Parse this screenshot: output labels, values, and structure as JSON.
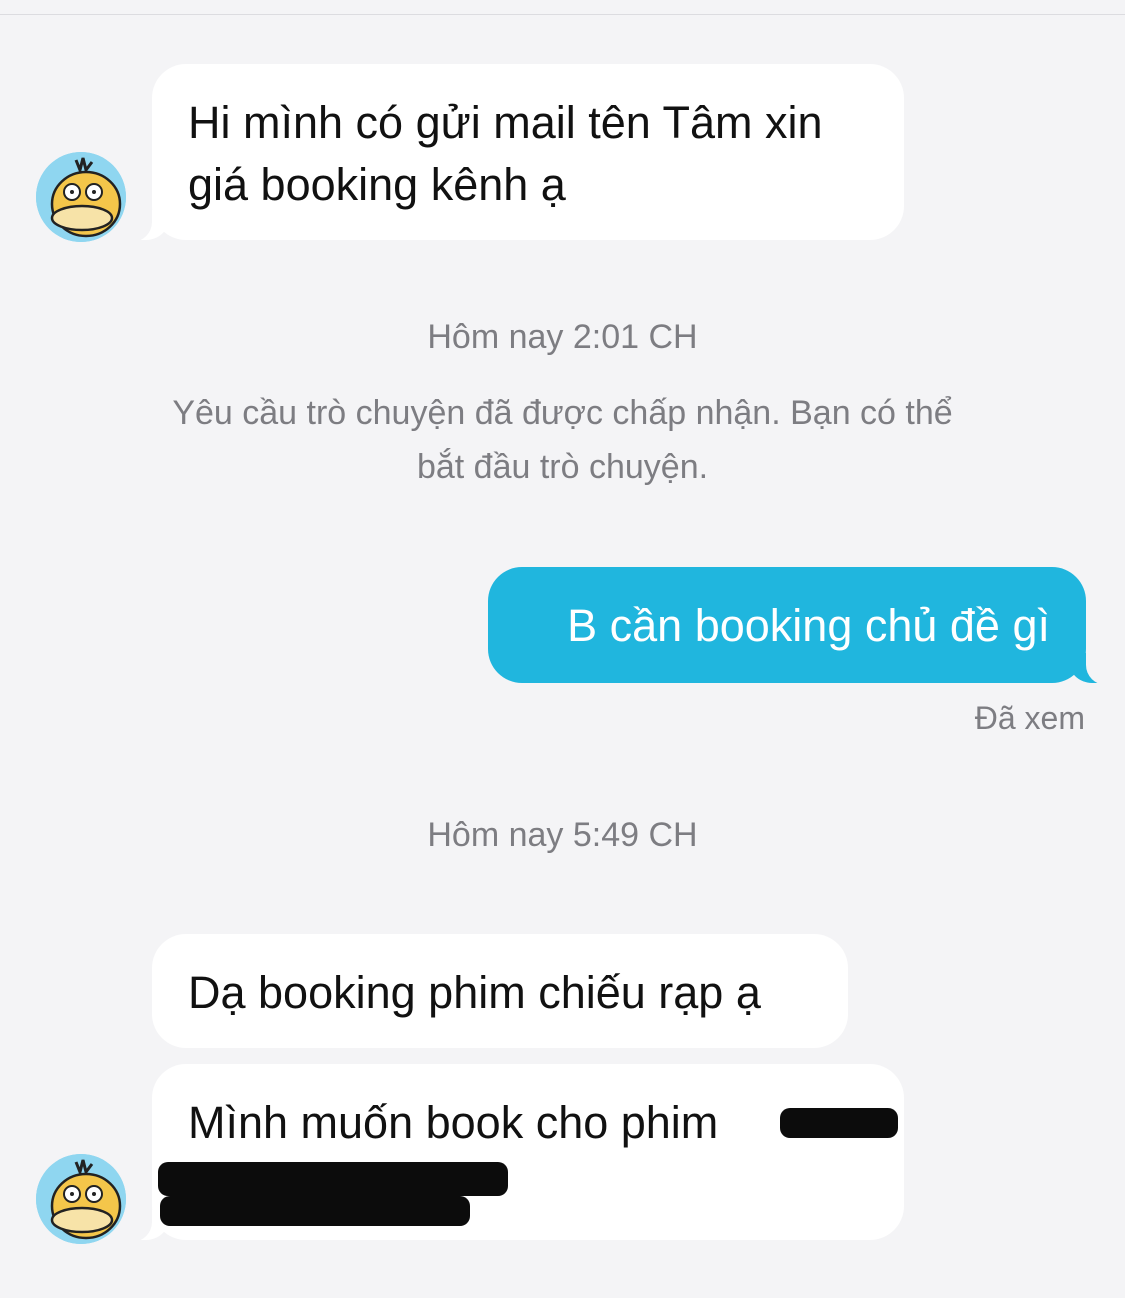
{
  "conversation": {
    "messages": [
      {
        "direction": "incoming",
        "text": "Hi mình có gửi mail tên Tâm xin giá booking kênh ạ"
      },
      {
        "direction": "outgoing",
        "text": "B cần booking chủ đề gì",
        "status": "Đã xem"
      },
      {
        "direction": "incoming",
        "text": "Dạ booking phim chiếu rạp ạ"
      },
      {
        "direction": "incoming",
        "text": "Mình muốn book cho phim",
        "redacted": true
      }
    ],
    "separators": [
      {
        "time": "Hôm nay 2:01 CH",
        "note": "Yêu cầu trò chuyện đã được chấp nhận. Bạn có thể bắt đầu trò chuyện."
      },
      {
        "time": "Hôm nay 5:49 CH"
      }
    ]
  },
  "colors": {
    "background": "#f4f4f6",
    "incoming_bubble": "#ffffff",
    "outgoing_bubble": "#20b6de",
    "meta_text": "#7d7d82"
  },
  "icons": {
    "avatar": "psyduck-avatar-icon"
  }
}
